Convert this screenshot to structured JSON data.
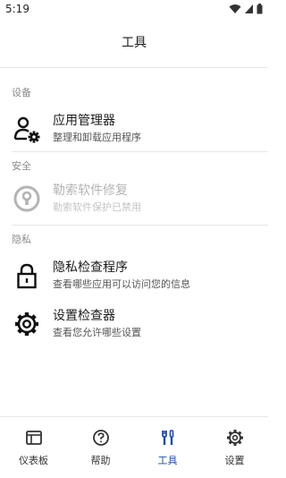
{
  "status_bar": {
    "time": "5:19"
  },
  "header": {
    "title": "工具"
  },
  "sections": [
    {
      "label": "设备",
      "items": [
        {
          "title": "应用管理器",
          "subtitle": "整理和卸载应用程序",
          "icon": "user-gear-icon",
          "enabled": true
        }
      ]
    },
    {
      "label": "安全",
      "items": [
        {
          "title": "勒索软件修复",
          "subtitle": "勒索软件保护已禁用",
          "icon": "keyhole-icon",
          "enabled": false
        }
      ]
    },
    {
      "label": "隐私",
      "items": [
        {
          "title": "隐私检查程序",
          "subtitle": "查看哪些应用可以访问您的信息",
          "icon": "padlock-icon",
          "enabled": true
        },
        {
          "title": "设置检查器",
          "subtitle": "查看您允许哪些设置",
          "icon": "gear-icon",
          "enabled": true
        }
      ]
    }
  ],
  "bottom_nav": {
    "tabs": [
      {
        "label": "仪表板",
        "icon": "dashboard-icon",
        "active": false
      },
      {
        "label": "帮助",
        "icon": "help-icon",
        "active": false
      },
      {
        "label": "工具",
        "icon": "tools-icon",
        "active": true
      },
      {
        "label": "设置",
        "icon": "settings-icon",
        "active": false
      }
    ]
  },
  "colors": {
    "accent": "#1a4bb7",
    "disabled": "#b4b4b4"
  }
}
